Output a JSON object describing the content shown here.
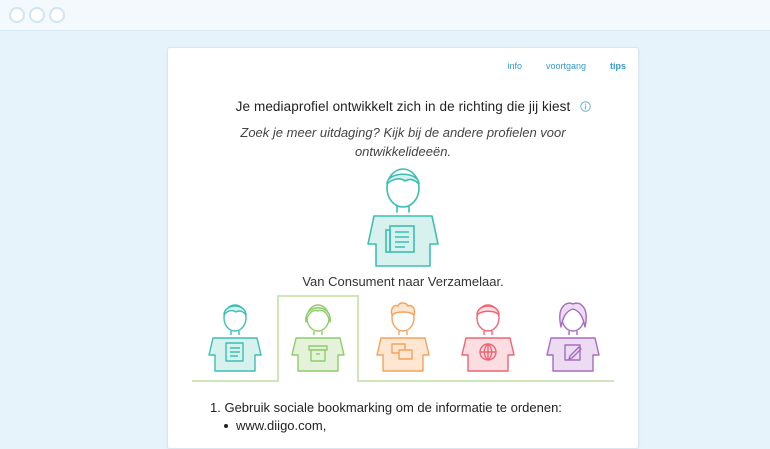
{
  "window": {
    "controls": [
      "close",
      "minimize",
      "maximize"
    ]
  },
  "nav": {
    "info": "info",
    "progress": "voortgang",
    "tips": "tips",
    "active": "tips"
  },
  "header": {
    "title": "Je mediaprofiel ontwikkelt zich in de richting die jij kiest",
    "subtitle": "Zoek je meer uitdaging? Kijk bij de andere profielen voor ontwikkelideeën."
  },
  "current_profile": {
    "caption": "Van Consument naar Verzamelaar.",
    "icon": "document-icon",
    "color": "#3cbfb3"
  },
  "profiles": [
    {
      "id": "consument",
      "icon": "document-icon",
      "color": "#3cbfb3",
      "fill": "#d6f1ee",
      "selected": false
    },
    {
      "id": "verzamelaar",
      "icon": "box-icon",
      "color": "#8fcc6a",
      "fill": "#e3f2d8",
      "selected": true
    },
    {
      "id": "orange",
      "icon": "chat-icon",
      "color": "#f5a25a",
      "fill": "#fde6d2",
      "selected": false
    },
    {
      "id": "red",
      "icon": "globe-icon",
      "color": "#ef6474",
      "fill": "#fcdde1",
      "selected": false
    },
    {
      "id": "purple",
      "icon": "edit-icon",
      "color": "#a76bbf",
      "fill": "#ecdcf2",
      "selected": false
    }
  ],
  "tips": {
    "step1": "Gebruik sociale bookmarking om de informatie te ordenen:",
    "step1_number": "1.",
    "links": [
      "www.diigo.com,"
    ]
  },
  "colors": {
    "link": "#3a98c9",
    "highlight": "#cfe7b8",
    "background": "#e6f3fb"
  }
}
